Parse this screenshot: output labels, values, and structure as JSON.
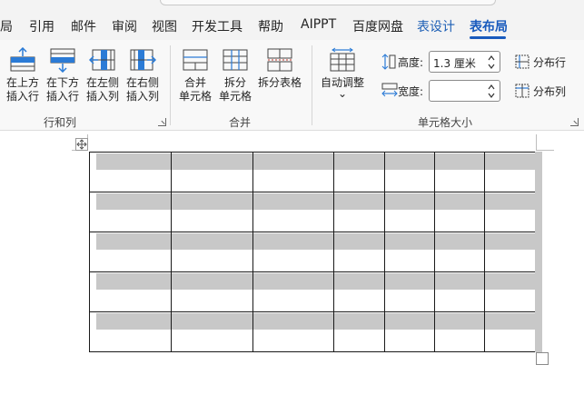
{
  "tabs": [
    {
      "label": "局",
      "kind": "normal"
    },
    {
      "label": "引用",
      "kind": "normal"
    },
    {
      "label": "邮件",
      "kind": "normal"
    },
    {
      "label": "审阅",
      "kind": "normal"
    },
    {
      "label": "视图",
      "kind": "normal"
    },
    {
      "label": "开发工具",
      "kind": "normal"
    },
    {
      "label": "帮助",
      "kind": "normal"
    },
    {
      "label": "AIPPT",
      "kind": "normal"
    },
    {
      "label": "百度网盘",
      "kind": "normal"
    },
    {
      "label": "表设计",
      "kind": "context"
    },
    {
      "label": "表布局",
      "kind": "active"
    }
  ],
  "ribbon": {
    "rows_cols": {
      "group_label": "行和列",
      "insert_above": {
        "line1": "在上方",
        "line2": "插入行"
      },
      "insert_below": {
        "line1": "在下方",
        "line2": "插入行"
      },
      "insert_left": {
        "line1": "在左侧",
        "line2": "插入列"
      },
      "insert_right": {
        "line1": "在右侧",
        "line2": "插入列"
      }
    },
    "merge": {
      "group_label": "合并",
      "merge_cells": {
        "line1": "合并",
        "line2": "单元格"
      },
      "split_cells": {
        "line1": "拆分",
        "line2": "单元格"
      },
      "split_table": {
        "line1": "拆分表格"
      }
    },
    "cell_size": {
      "group_label": "单元格大小",
      "autofit": {
        "line1": "自动调整",
        "arrow": "⌄"
      },
      "height_label": "高度:",
      "height_value": "1.3 厘米",
      "width_label": "宽度:",
      "width_value": "",
      "distribute_rows": "分布行",
      "distribute_cols": "分布列"
    }
  },
  "colors": {
    "accent": "#185abd",
    "context_tab": "#1d5fb5",
    "cell_shading": "#c8c8c8",
    "icon_blue": "#2b7bd6"
  },
  "table": {
    "rows": 5,
    "cols": 7
  }
}
